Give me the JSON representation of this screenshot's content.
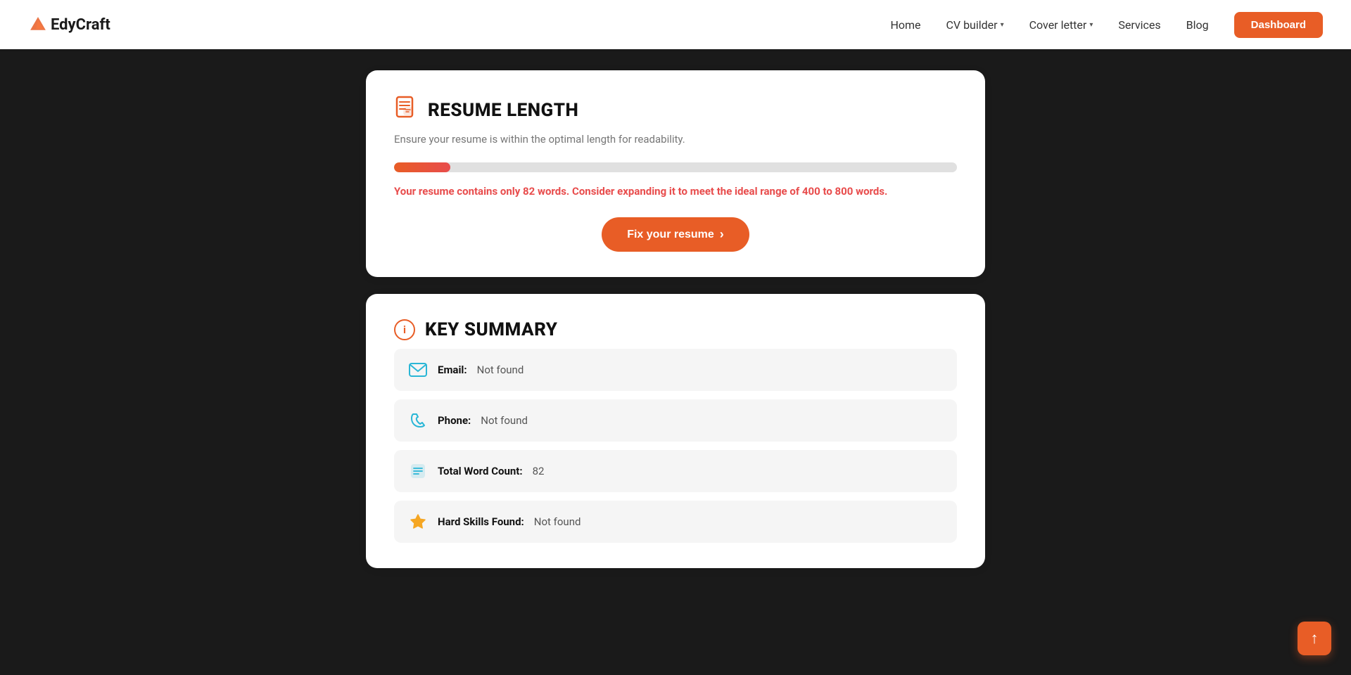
{
  "logo": {
    "text_edy": "EdyCraft",
    "icon_unicode": "▲"
  },
  "navbar": {
    "home": "Home",
    "cv_builder": "CV builder",
    "cover_letter": "Cover letter",
    "services": "Services",
    "blog": "Blog",
    "dashboard": "Dashboard"
  },
  "resume_length_card": {
    "title": "RESUME LENGTH",
    "subtitle": "Ensure your resume is within the optimal length for readability.",
    "progress_percent": 10,
    "warning_text": "Your resume contains only 82 words. Consider expanding it to meet the ideal range of 400 to 800 words.",
    "fix_button": "Fix your resume"
  },
  "key_summary_card": {
    "title": "KEY SUMMARY",
    "rows": [
      {
        "label": "Email:",
        "value": "Not found",
        "icon_type": "email"
      },
      {
        "label": "Phone:",
        "value": "Not found",
        "icon_type": "phone"
      },
      {
        "label": "Total Word Count:",
        "value": "82",
        "icon_type": "wordcount"
      },
      {
        "label": "Hard Skills Found:",
        "value": "Not found",
        "icon_type": "hardskills"
      }
    ]
  },
  "scroll_top_label": "↑"
}
